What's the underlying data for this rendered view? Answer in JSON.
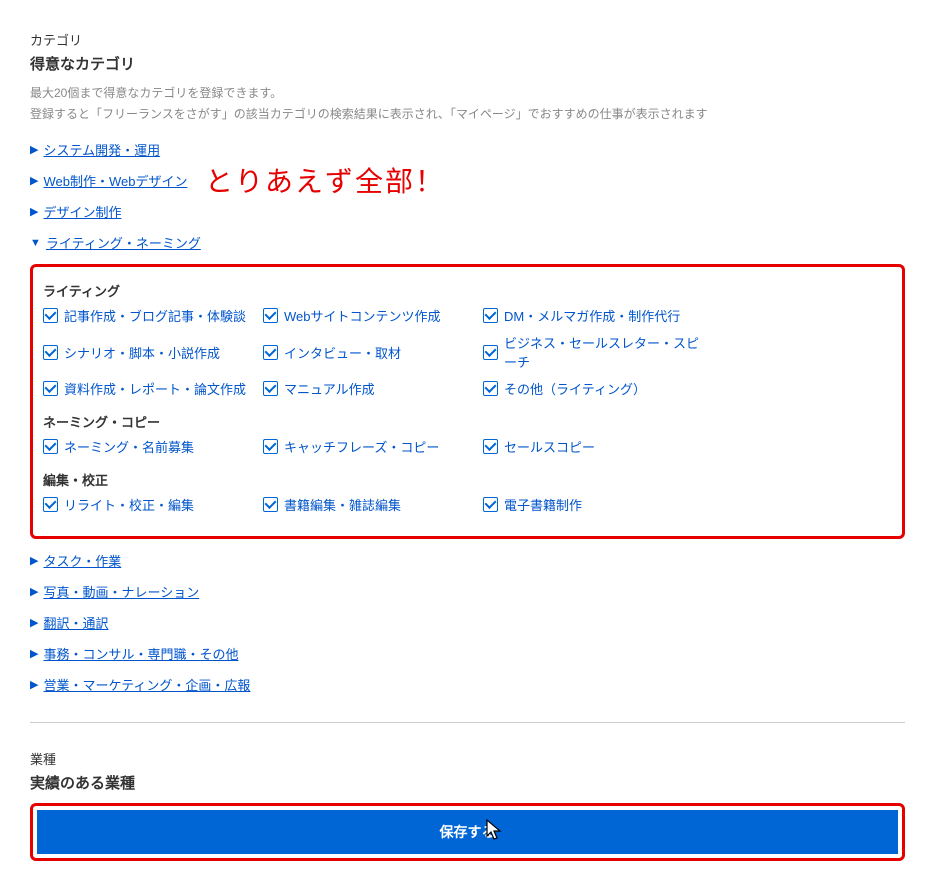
{
  "header": {
    "section_label": "カテゴリ",
    "title": "得意なカテゴリ",
    "note1": "最大20個まで得意なカテゴリを登録できます。",
    "note2": "登録すると「フリーランスをさがす」の該当カテゴリの検索結果に表示され、「マイページ」でおすすめの仕事が表示されます"
  },
  "annotation": "とりあえず全部！",
  "categories": {
    "collapsed_before": [
      "システム開発・運用",
      "Web制作・Webデザイン",
      "デザイン制作"
    ],
    "expanded": {
      "label": "ライティング・ネーミング",
      "groups": [
        {
          "title": "ライティング",
          "items": [
            "記事作成・ブログ記事・体験談",
            "Webサイトコンテンツ作成",
            "DM・メルマガ作成・制作代行",
            "シナリオ・脚本・小説作成",
            "インタビュー・取材",
            "ビジネス・セールスレター・スピーチ",
            "資料作成・レポート・論文作成",
            "マニュアル作成",
            "その他（ライティング）"
          ]
        },
        {
          "title": "ネーミング・コピー",
          "items": [
            "ネーミング・名前募集",
            "キャッチフレーズ・コピー",
            "セールスコピー"
          ]
        },
        {
          "title": "編集・校正",
          "items": [
            "リライト・校正・編集",
            "書籍編集・雑誌編集",
            "電子書籍制作"
          ]
        }
      ]
    },
    "collapsed_after": [
      "タスク・作業",
      "写真・動画・ナレーション",
      "翻訳・通訳",
      "事務・コンサル・専門職・その他",
      "営業・マーケティング・企画・広報"
    ]
  },
  "industry": {
    "section_label": "業種",
    "title": "実績のある業種"
  },
  "save_button": "保存する"
}
